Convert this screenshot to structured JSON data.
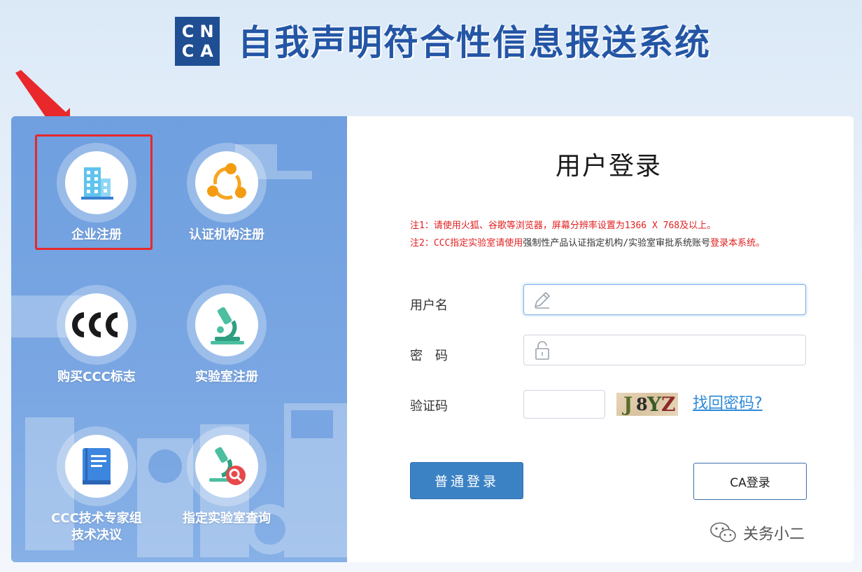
{
  "header": {
    "logo_letters": [
      "C",
      "N",
      "C",
      "A"
    ],
    "system_title": "自我声明符合性信息报送系统"
  },
  "left_panel": {
    "tiles": [
      {
        "label": "企业注册",
        "icon": "building-icon"
      },
      {
        "label": "认证机构注册",
        "icon": "network-nodes-icon"
      },
      {
        "label": "购买CCC标志",
        "icon": "ccc-mark-icon"
      },
      {
        "label": "实验室注册",
        "icon": "microscope-icon"
      },
      {
        "label": "CCC技术专家组技术决议",
        "icon": "book-icon"
      },
      {
        "label": "指定实验室查询",
        "icon": "microscope-search-icon"
      }
    ]
  },
  "login": {
    "title": "用户登录",
    "note1": "注1：请使用火狐、谷歌等浏览器，屏幕分辨率设置为1366 X 768及以上。",
    "note2_a": "注2：CCC指定实验室请使用",
    "note2_b": "强制性产品认证指定机构/实验室审批系统账号",
    "note2_c": "登录本系统。",
    "username_label": "用户名",
    "username_value": "",
    "password_label": "密　码",
    "password_value": "",
    "captcha_label": "验证码",
    "captcha_value": "",
    "captcha_text": [
      "J",
      "8",
      "Y",
      "Z"
    ],
    "forgot_link": "找回密码?",
    "normal_login": "普通登录",
    "ca_login": "CA登录"
  },
  "watermark": {
    "text": "关务小二"
  },
  "colors": {
    "title_blue": "#2456a6",
    "panel_blue": "#7aa7e3",
    "note_red": "#e02020",
    "button_blue": "#3b82c4",
    "highlight_red": "#e8282b"
  }
}
